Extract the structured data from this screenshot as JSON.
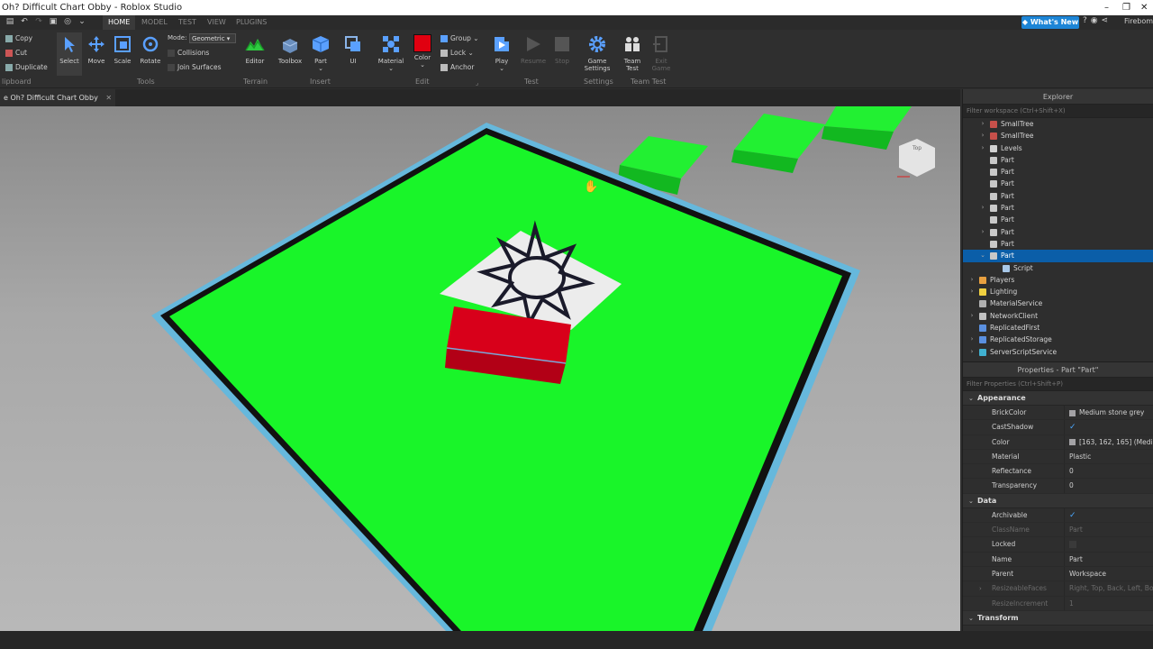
{
  "window": {
    "title": "Oh? Difficult Chart Obby - Roblox Studio",
    "controls": [
      "–",
      "❐",
      "✕"
    ]
  },
  "menu": {
    "tabs": [
      "HOME",
      "MODEL",
      "TEST",
      "VIEW",
      "PLUGINS"
    ],
    "whats_new": "◆ What's New",
    "user": "Firebom"
  },
  "ribbon": {
    "clipboard": {
      "copy": "Copy",
      "cut": "Cut",
      "duplicate": "Duplicate",
      "label": "lipboard"
    },
    "tools": {
      "select": "Select",
      "move": "Move",
      "scale": "Scale",
      "rotate": "Rotate",
      "mode_label": "Mode:",
      "mode_value": "Geometric",
      "collisions": "Collisions",
      "join_surfaces": "Join Surfaces",
      "label": "Tools"
    },
    "terrain": {
      "editor": "Editor",
      "label": "Terrain"
    },
    "insert": {
      "toolbox": "Toolbox",
      "part": "Part",
      "ui": "UI",
      "label": "Insert"
    },
    "edit": {
      "material": "Material",
      "color": "Color",
      "group": "Group",
      "lock": "Lock",
      "anchor": "Anchor",
      "label": "Edit"
    },
    "test": {
      "play": "Play",
      "resume": "Resume",
      "stop": "Stop",
      "label": "Test"
    },
    "settings": {
      "game_settings_1": "Game",
      "game_settings_2": "Settings",
      "label": "Settings"
    },
    "team_test": {
      "team_test_1": "Team",
      "team_test_2": "Test",
      "exit_game_1": "Exit",
      "exit_game_2": "Game",
      "label": "Team Test"
    }
  },
  "doc_tab": {
    "label": "e Oh? Difficult Chart Obby",
    "close": "✕"
  },
  "viewport": {
    "ui_toggle": "UI",
    "view_cube_label": "Top"
  },
  "explorer": {
    "title": "Explorer",
    "filter_placeholder": "Filter workspace (Ctrl+Shift+X)",
    "items": [
      {
        "label": "SmallTree",
        "arrow": "›",
        "indent": 1,
        "icon": "model"
      },
      {
        "label": "SmallTree",
        "arrow": "›",
        "indent": 1,
        "icon": "model"
      },
      {
        "label": "Levels",
        "arrow": "›",
        "indent": 1,
        "icon": "folder"
      },
      {
        "label": "Part",
        "arrow": "",
        "indent": 1,
        "icon": "part"
      },
      {
        "label": "Part",
        "arrow": "",
        "indent": 1,
        "icon": "part"
      },
      {
        "label": "Part",
        "arrow": "",
        "indent": 1,
        "icon": "part"
      },
      {
        "label": "Part",
        "arrow": "",
        "indent": 1,
        "icon": "part"
      },
      {
        "label": "Part",
        "arrow": "›",
        "indent": 1,
        "icon": "part"
      },
      {
        "label": "Part",
        "arrow": "",
        "indent": 1,
        "icon": "part"
      },
      {
        "label": "Part",
        "arrow": "›",
        "indent": 1,
        "icon": "part"
      },
      {
        "label": "Part",
        "arrow": "",
        "indent": 1,
        "icon": "part"
      },
      {
        "label": "Part",
        "arrow": "⌄",
        "indent": 1,
        "icon": "part",
        "selected": true
      },
      {
        "label": "Script",
        "arrow": "",
        "indent": 2,
        "icon": "script"
      },
      {
        "label": "Players",
        "arrow": "›",
        "indent": 0,
        "icon": "players"
      },
      {
        "label": "Lighting",
        "arrow": "›",
        "indent": 0,
        "icon": "lighting"
      },
      {
        "label": "MaterialService",
        "arrow": "",
        "indent": 0,
        "icon": "material"
      },
      {
        "label": "NetworkClient",
        "arrow": "›",
        "indent": 0,
        "icon": "network"
      },
      {
        "label": "ReplicatedFirst",
        "arrow": "",
        "indent": 0,
        "icon": "replicated"
      },
      {
        "label": "ReplicatedStorage",
        "arrow": "›",
        "indent": 0,
        "icon": "replicated"
      },
      {
        "label": "ServerScriptService",
        "arrow": "›",
        "indent": 0,
        "icon": "server"
      }
    ]
  },
  "properties": {
    "title": "Properties - Part \"Part\"",
    "filter_placeholder": "Filter Properties (Ctrl+Shift+P)",
    "sections": [
      {
        "name": "Appearance",
        "rows": [
          {
            "name": "BrickColor",
            "value": "Medium stone grey",
            "swatch": "#a3a2a5"
          },
          {
            "name": "CastShadow",
            "value": "✓",
            "check": true
          },
          {
            "name": "Color",
            "value": "[163, 162, 165] (Medium",
            "swatch": "#a3a2a5"
          },
          {
            "name": "Material",
            "value": "Plastic"
          },
          {
            "name": "Reflectance",
            "value": "0"
          },
          {
            "name": "Transparency",
            "value": "0"
          }
        ]
      },
      {
        "name": "Data",
        "rows": [
          {
            "name": "Archivable",
            "value": "✓",
            "check": true
          },
          {
            "name": "ClassName",
            "value": "Part",
            "dim": true
          },
          {
            "name": "Locked",
            "value": ""
          },
          {
            "name": "Name",
            "value": "Part"
          },
          {
            "name": "Parent",
            "value": "Workspace"
          },
          {
            "name": "ResizeableFaces",
            "value": "Right, Top, Back, Left, Botto",
            "dim": true,
            "arrow": true
          },
          {
            "name": "ResizeIncrement",
            "value": "1",
            "dim": true
          }
        ]
      },
      {
        "name": "Transform",
        "rows": []
      }
    ]
  },
  "colors": {
    "accent": "#1c85d6",
    "selected": "#0b5ea8",
    "platform_green": "#19f529",
    "checkpoint_red": "#d8001a"
  }
}
